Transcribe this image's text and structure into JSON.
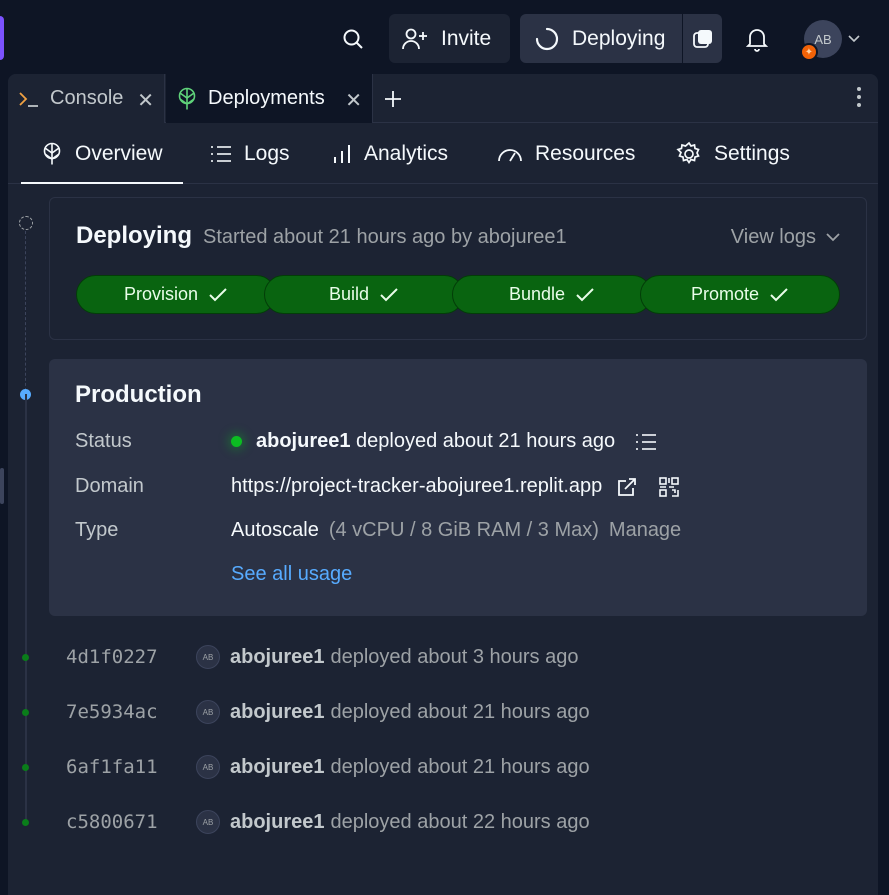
{
  "topbar": {
    "invite_label": "Invite",
    "deploy_label": "Deploying",
    "avatar_initials": "AB"
  },
  "tabs": [
    {
      "label": "Console",
      "icon": "terminal-icon"
    },
    {
      "label": "Deployments",
      "icon": "deploy-icon"
    }
  ],
  "subnav": [
    {
      "label": "Overview",
      "icon": "deploy-icon",
      "active": true
    },
    {
      "label": "Logs",
      "icon": "list-icon"
    },
    {
      "label": "Analytics",
      "icon": "bar-chart-icon"
    },
    {
      "label": "Resources",
      "icon": "gauge-icon"
    },
    {
      "label": "Settings",
      "icon": "gear-icon"
    }
  ],
  "deploying": {
    "title": "Deploying",
    "subtitle": "Started about 21 hours ago by abojuree1",
    "view_logs": "View logs",
    "steps": [
      "Provision",
      "Build",
      "Bundle",
      "Promote"
    ]
  },
  "production": {
    "title": "Production",
    "status_label": "Status",
    "status_user": "abojuree1",
    "status_text": "deployed about 21 hours ago",
    "domain_label": "Domain",
    "domain_value": "https://project-tracker-abojuree1.replit.app",
    "type_label": "Type",
    "type_value": "Autoscale",
    "type_spec": "(4 vCPU / 8 GiB RAM / 3 Max)",
    "manage": "Manage",
    "usage_link": "See all usage"
  },
  "history": [
    {
      "hash": "4d1f0227",
      "user": "abojuree1",
      "text": "deployed about 3 hours ago"
    },
    {
      "hash": "7e5934ac",
      "user": "abojuree1",
      "text": "deployed about 21 hours ago"
    },
    {
      "hash": "6af1fa11",
      "user": "abojuree1",
      "text": "deployed about 21 hours ago"
    },
    {
      "hash": "c5800671",
      "user": "abojuree1",
      "text": "deployed about 22 hours ago"
    }
  ],
  "history_avatar": "AB",
  "colors": {
    "background": "#0e1525",
    "surface": "#1c2333",
    "surface_raised": "#2b3245",
    "step_green": "#096410",
    "status_green": "#0cbd22",
    "link_blue": "#57abff",
    "brand_purple": "#7b52ff"
  }
}
